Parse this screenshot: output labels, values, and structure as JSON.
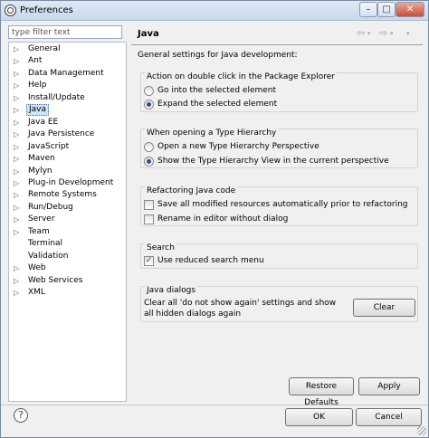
{
  "window": {
    "title": "Preferences",
    "controls": {
      "minimize": "–",
      "maximize": "□",
      "close": "✕"
    }
  },
  "filter": {
    "placeholder": "type filter text",
    "value": ""
  },
  "tree": {
    "items": [
      {
        "label": "General",
        "expandable": true,
        "selected": false
      },
      {
        "label": "Ant",
        "expandable": true,
        "selected": false
      },
      {
        "label": "Data Management",
        "expandable": true,
        "selected": false
      },
      {
        "label": "Help",
        "expandable": true,
        "selected": false
      },
      {
        "label": "Install/Update",
        "expandable": true,
        "selected": false
      },
      {
        "label": "Java",
        "expandable": true,
        "selected": true
      },
      {
        "label": "Java EE",
        "expandable": true,
        "selected": false
      },
      {
        "label": "Java Persistence",
        "expandable": true,
        "selected": false
      },
      {
        "label": "JavaScript",
        "expandable": true,
        "selected": false
      },
      {
        "label": "Maven",
        "expandable": true,
        "selected": false
      },
      {
        "label": "Mylyn",
        "expandable": true,
        "selected": false
      },
      {
        "label": "Plug-in Development",
        "expandable": true,
        "selected": false
      },
      {
        "label": "Remote Systems",
        "expandable": true,
        "selected": false
      },
      {
        "label": "Run/Debug",
        "expandable": true,
        "selected": false
      },
      {
        "label": "Server",
        "expandable": true,
        "selected": false
      },
      {
        "label": "Team",
        "expandable": true,
        "selected": false
      },
      {
        "label": "Terminal",
        "expandable": false,
        "selected": false
      },
      {
        "label": "Validation",
        "expandable": false,
        "selected": false
      },
      {
        "label": "Web",
        "expandable": true,
        "selected": false
      },
      {
        "label": "Web Services",
        "expandable": true,
        "selected": false
      },
      {
        "label": "XML",
        "expandable": true,
        "selected": false
      }
    ]
  },
  "page": {
    "title": "Java",
    "intro": "General settings for Java development:",
    "groups": {
      "package_explorer": {
        "title": "Action on double click in the Package Explorer",
        "options": [
          {
            "label": "Go into the selected element",
            "checked": false
          },
          {
            "label": "Expand the selected element",
            "checked": true
          }
        ]
      },
      "type_hierarchy": {
        "title": "When opening a Type Hierarchy",
        "options": [
          {
            "label": "Open a new Type Hierarchy Perspective",
            "checked": false
          },
          {
            "label": "Show the Type Hierarchy View in the current perspective",
            "checked": true
          }
        ]
      },
      "refactoring": {
        "title": "Refactoring Java code",
        "options": [
          {
            "label": "Save all modified resources automatically prior to refactoring",
            "checked": false
          },
          {
            "label": "Rename in editor without dialog",
            "checked": false
          }
        ]
      },
      "search": {
        "title": "Search",
        "options": [
          {
            "label": "Use reduced search menu",
            "checked": true
          }
        ]
      },
      "java_dialogs": {
        "title": "Java dialogs",
        "text": "Clear all 'do not show again' settings and show all hidden dialogs again",
        "button": "Clear"
      }
    },
    "buttons": {
      "restore_defaults": "Restore Defaults",
      "apply": "Apply"
    }
  },
  "footer": {
    "help": "?",
    "ok": "OK",
    "cancel": "Cancel"
  },
  "colors": {
    "selection": "#cde3f7",
    "accent": "#2a4f8f"
  }
}
